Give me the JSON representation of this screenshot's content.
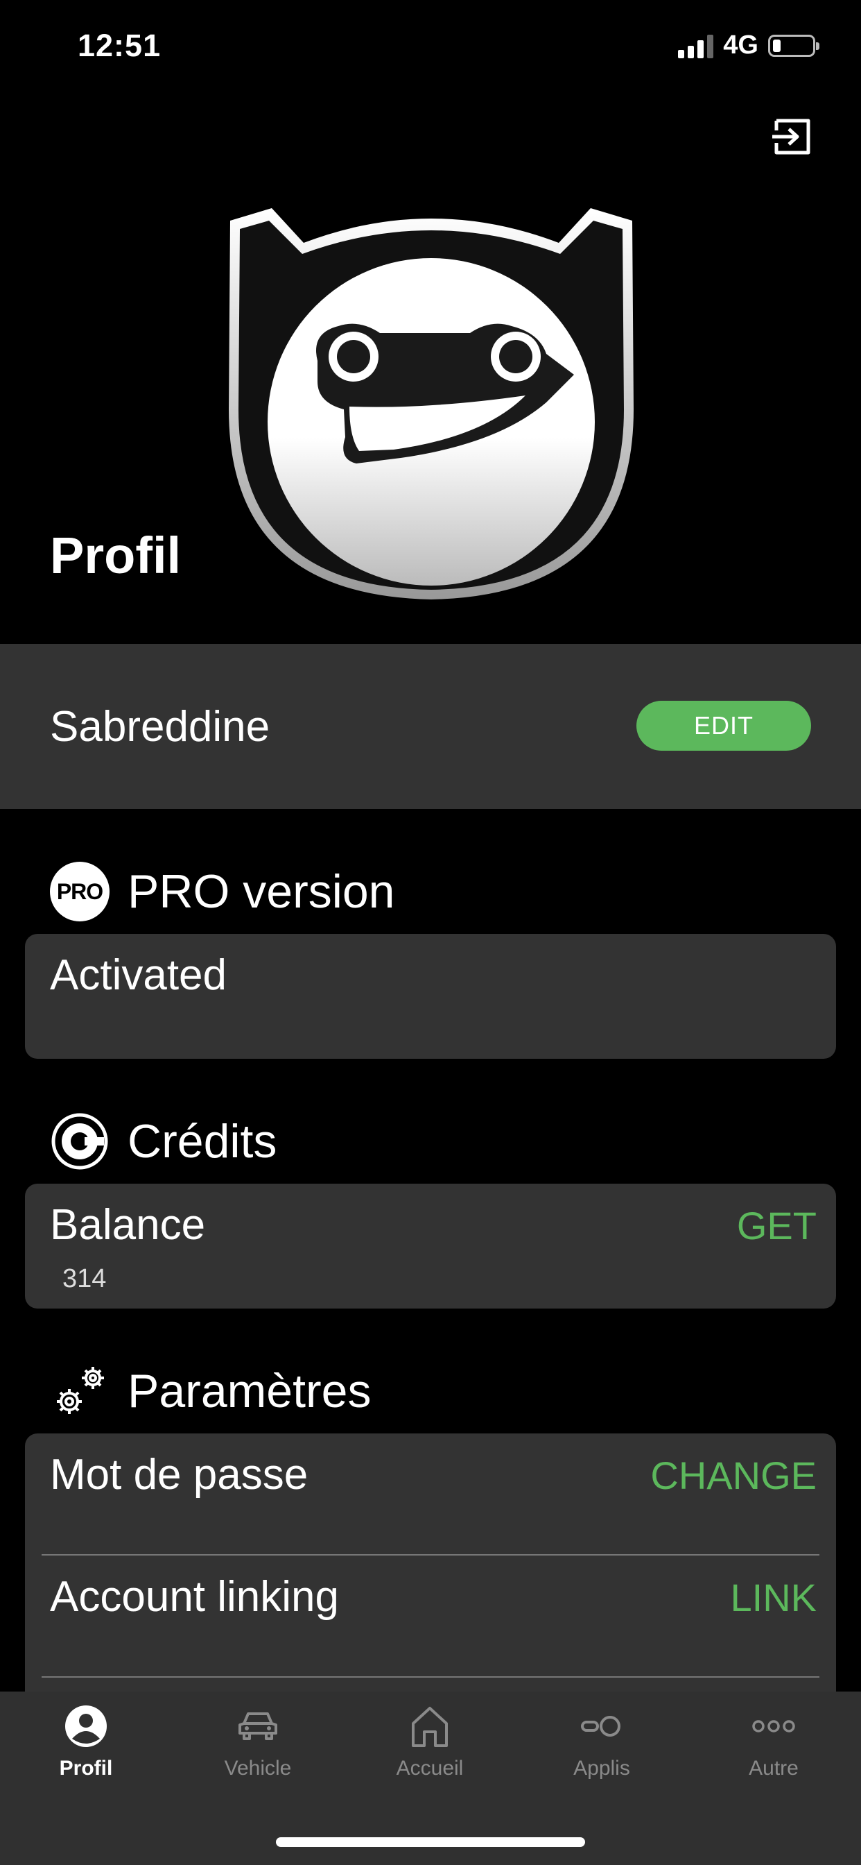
{
  "status_bar": {
    "time": "12:51",
    "network": "4G",
    "battery_level": 0.2
  },
  "header": {
    "title": "Profil",
    "logout_icon": "logout-icon",
    "logo_icon": "frog-car-logo"
  },
  "user": {
    "name": "Sabreddine",
    "edit_label": "EDIT"
  },
  "pro": {
    "badge": "PRO",
    "title": "PRO version",
    "status": "Activated"
  },
  "credits": {
    "title": "Crédits",
    "icon": "credits-icon",
    "label": "Balance",
    "value": "314",
    "action": "GET"
  },
  "settings": {
    "title": "Paramètres",
    "icon": "gears-icon",
    "rows": [
      {
        "label": "Mot de passe",
        "action": "CHANGE"
      },
      {
        "label": "Account linking",
        "action": "LINK"
      }
    ]
  },
  "tabbar": {
    "tabs": [
      {
        "label": "Profil",
        "icon": "profile-icon",
        "active": true
      },
      {
        "label": "Vehicle",
        "icon": "car-icon",
        "active": false
      },
      {
        "label": "Accueil",
        "icon": "home-icon",
        "active": false
      },
      {
        "label": "Applis",
        "icon": "apps-icon",
        "active": false
      },
      {
        "label": "Autre",
        "icon": "more-icon",
        "active": false
      }
    ]
  },
  "colors": {
    "accent": "#5cb85c",
    "card": "#333333",
    "background": "#000000"
  }
}
